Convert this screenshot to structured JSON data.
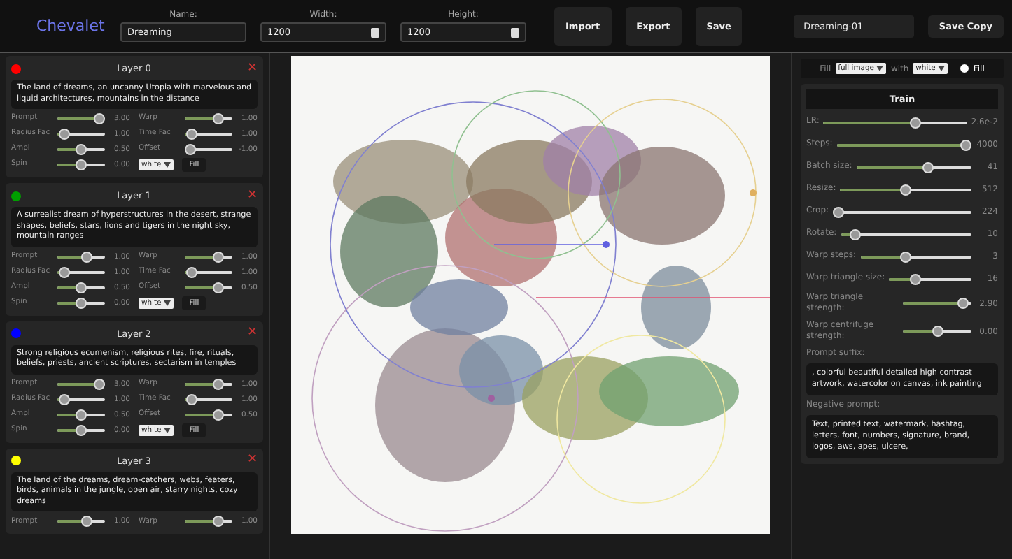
{
  "app": {
    "title": "Chevalet"
  },
  "toolbar": {
    "name": {
      "label": "Name:",
      "value": "Dreaming"
    },
    "width": {
      "label": "Width:",
      "value": "1200"
    },
    "height": {
      "label": "Height:",
      "value": "1200"
    },
    "buttons": [
      "Import",
      "Export",
      "Save"
    ],
    "save_name": "Dreaming-01",
    "save_copy": "Save Copy"
  },
  "layers": [
    {
      "title": "Layer 0",
      "close": "✕",
      "color": "#ff0000",
      "prompt": "The land of dreams, an uncanny Utopia with marvelous and liquid architectures, mountains in the distance",
      "sliders": [
        {
          "label": "Prompt",
          "level": 1,
          "reading": "3.00"
        },
        {
          "label": "Warp",
          "level": 0.75,
          "reading": "1.00"
        },
        {
          "label": "Radius Fac",
          "level": 0.05,
          "reading": "1.00"
        },
        {
          "label": "Time Fac",
          "level": 0.05,
          "reading": "1.00"
        },
        {
          "label": "Ampl",
          "level": 0.5,
          "reading": "0.50"
        },
        {
          "label": "Offset",
          "level": 0,
          "reading": "-1.00"
        },
        {
          "label": "Spin",
          "level": 0.5,
          "reading": "0.00"
        }
      ],
      "fill_color": "white",
      "fill_button": "Fill"
    },
    {
      "title": "Layer 1",
      "close": "✕",
      "color": "#00a000",
      "prompt": "A surrealist dream of hyperstructures in the desert, strange shapes, beliefs, stars, lions and tigers in the night sky, mountain ranges",
      "sliders": [
        {
          "label": "Prompt",
          "level": 0.66,
          "reading": "1.00"
        },
        {
          "label": "Warp",
          "level": 0.75,
          "reading": "1.00"
        },
        {
          "label": "Radius Fac",
          "level": 0.05,
          "reading": "1.00"
        },
        {
          "label": "Time Fac",
          "level": 0.05,
          "reading": "1.00"
        },
        {
          "label": "Ampl",
          "level": 0.5,
          "reading": "0.50"
        },
        {
          "label": "Offset",
          "level": 0.75,
          "reading": "0.50"
        },
        {
          "label": "Spin",
          "level": 0.5,
          "reading": "0.00"
        }
      ],
      "fill_color": "white",
      "fill_button": "Fill"
    },
    {
      "title": "Layer 2",
      "close": "✕",
      "color": "#0000ff",
      "prompt": "Strong religious ecumenism, religious rites, fire, rituals, beliefs, priests, ancient scriptures, sectarism in temples",
      "sliders": [
        {
          "label": "Prompt",
          "level": 1,
          "reading": "3.00"
        },
        {
          "label": "Warp",
          "level": 0.75,
          "reading": "1.00"
        },
        {
          "label": "Radius Fac",
          "level": 0.05,
          "reading": "1.00"
        },
        {
          "label": "Time Fac",
          "level": 0.05,
          "reading": "1.00"
        },
        {
          "label": "Ampl",
          "level": 0.5,
          "reading": "0.50"
        },
        {
          "label": "Offset",
          "level": 0.75,
          "reading": "0.50"
        },
        {
          "label": "Spin",
          "level": 0.5,
          "reading": "0.00"
        }
      ],
      "fill_color": "white",
      "fill_button": "Fill"
    },
    {
      "title": "Layer 3",
      "close": "✕",
      "color": "#ffff00",
      "prompt": "The land of the dreams, dream-catchers, webs, featers, birds, animals in the jungle, open air, starry nights, cozy dreams",
      "sliders": [
        {
          "label": "Prompt",
          "level": 0.66,
          "reading": "1.00"
        },
        {
          "label": "Warp",
          "level": 0.75,
          "reading": "1.00"
        }
      ]
    }
  ],
  "fill_bar": {
    "label": "Fill",
    "area": "full image",
    "with": "with",
    "color_option": "white",
    "radio": {
      "label": "Fill",
      "selected": false
    }
  },
  "train": {
    "button": "Train",
    "sliders": [
      {
        "label": "LR:",
        "level": 0.65,
        "reading": "2.6e-2"
      },
      {
        "label": "Steps:",
        "level": 1,
        "reading": "4000"
      },
      {
        "label": "Batch size:",
        "level": 0.63,
        "reading": "41"
      },
      {
        "label": "Resize:",
        "level": 0.5,
        "reading": "512"
      },
      {
        "label": "Crop:",
        "level": 0,
        "reading": "224"
      },
      {
        "label": "Rotate:",
        "level": 0.08,
        "reading": "10"
      },
      {
        "label": "Warp steps:",
        "level": 0.4,
        "reading": "3"
      },
      {
        "label": "Warp triangle size:",
        "level": 0.3,
        "reading": "16"
      },
      {
        "label": "Warp triangle strength:",
        "level": 0.95,
        "reading": "2.90"
      },
      {
        "label": "Warp centrifuge strength:",
        "level": 0.5,
        "reading": "0.00"
      }
    ],
    "prompt_suffix": {
      "label": "Prompt suffix:",
      "value": ", colorful beautiful detailed high contrast artwork, watercolor on canvas, ink painting"
    },
    "negative_prompt": {
      "label": "Negative prompt:",
      "value": "Text, printed text, watermark, hashtag, letters, font, numbers, signature, brand, logos, aws, apes, ulcere,"
    }
  }
}
